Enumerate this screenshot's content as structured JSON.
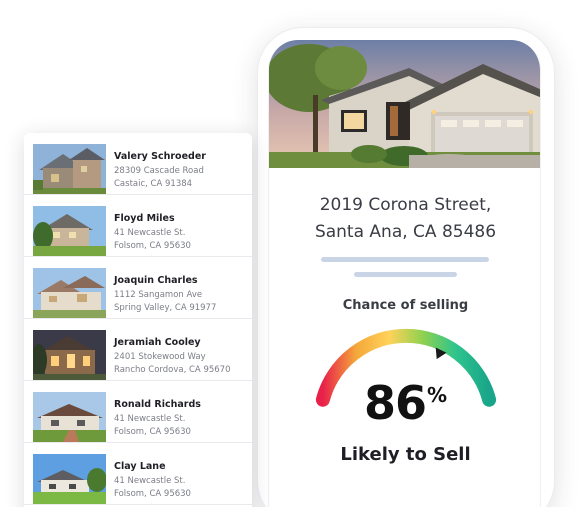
{
  "property": {
    "address_line1": "2019 Corona Street,",
    "address_line2": "Santa Ana, CA 85486"
  },
  "selling": {
    "title": "Chance of selling",
    "percent": "86",
    "percent_sign": "%",
    "verdict": "Likely to Sell",
    "gauge_level": 0.86,
    "gauge_colors": [
      "#e8214a",
      "#f4a83a",
      "#ffd25a",
      "#8fd14f",
      "#2ec48c",
      "#19a58a"
    ]
  },
  "listings": [
    {
      "name": "Valery Schroeder",
      "street": "28309 Cascade Road",
      "city": "Castaic, CA 91384"
    },
    {
      "name": "Floyd Miles",
      "street": "41 Newcastle St.",
      "city": "Folsom, CA 95630"
    },
    {
      "name": "Joaquin Charles",
      "street": "1112 Sangamon Ave",
      "city": "Spring Valley, CA 91977"
    },
    {
      "name": "Jeramiah Cooley",
      "street": "2401 Stokewood Way",
      "city": "Rancho Cordova, CA 95670"
    },
    {
      "name": "Ronald Richards",
      "street": "41 Newcastle St.",
      "city": "Folsom, CA 95630"
    },
    {
      "name": "Clay Lane",
      "street": "41 Newcastle St.",
      "city": "Folsom, CA 95630"
    }
  ]
}
